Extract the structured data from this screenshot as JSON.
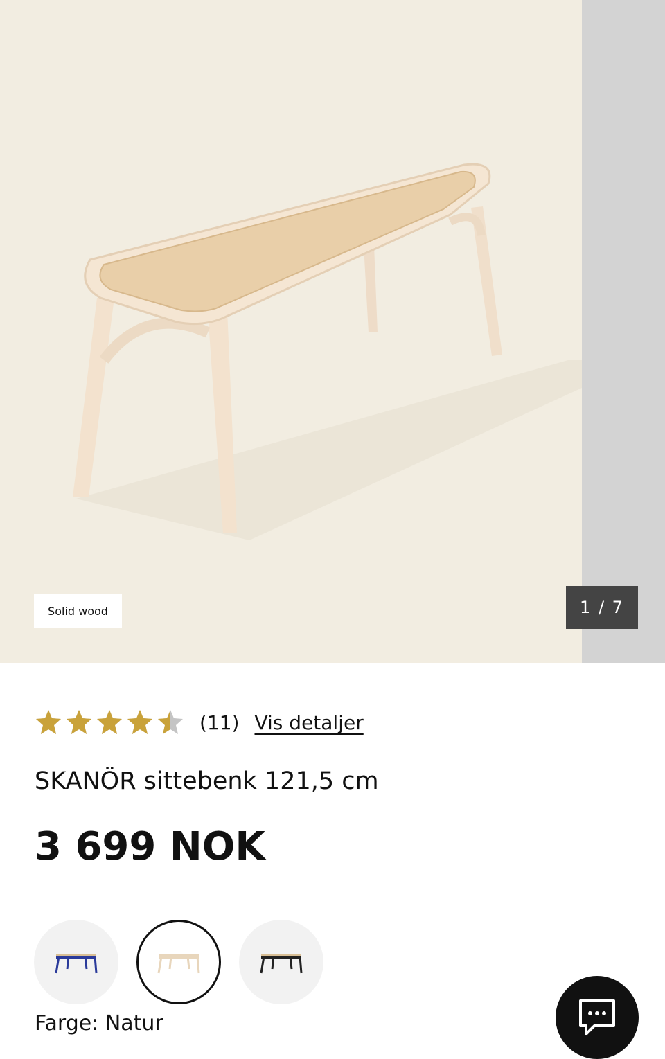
{
  "gallery": {
    "badge": "Solid wood",
    "counter": "1 / 7"
  },
  "rating": {
    "value": 4.5,
    "max": 5,
    "count": "(11)",
    "details_link": "Vis detaljer",
    "star_color": "#c9a23a",
    "empty_star_color": "#c4c4c4"
  },
  "product": {
    "name": "SKANÖR sittebenk 121,5 cm",
    "price": "3 699 NOK"
  },
  "variants": {
    "swatches": [
      {
        "name": "blue",
        "color": "#2a3a9a",
        "selected": false
      },
      {
        "name": "natural",
        "color": "#e8d6bc",
        "selected": true
      },
      {
        "name": "black",
        "color": "#222222",
        "selected": false
      }
    ],
    "color_label": "Farge: Natur"
  },
  "chat": {
    "icon": "chat-bubble-icon"
  }
}
